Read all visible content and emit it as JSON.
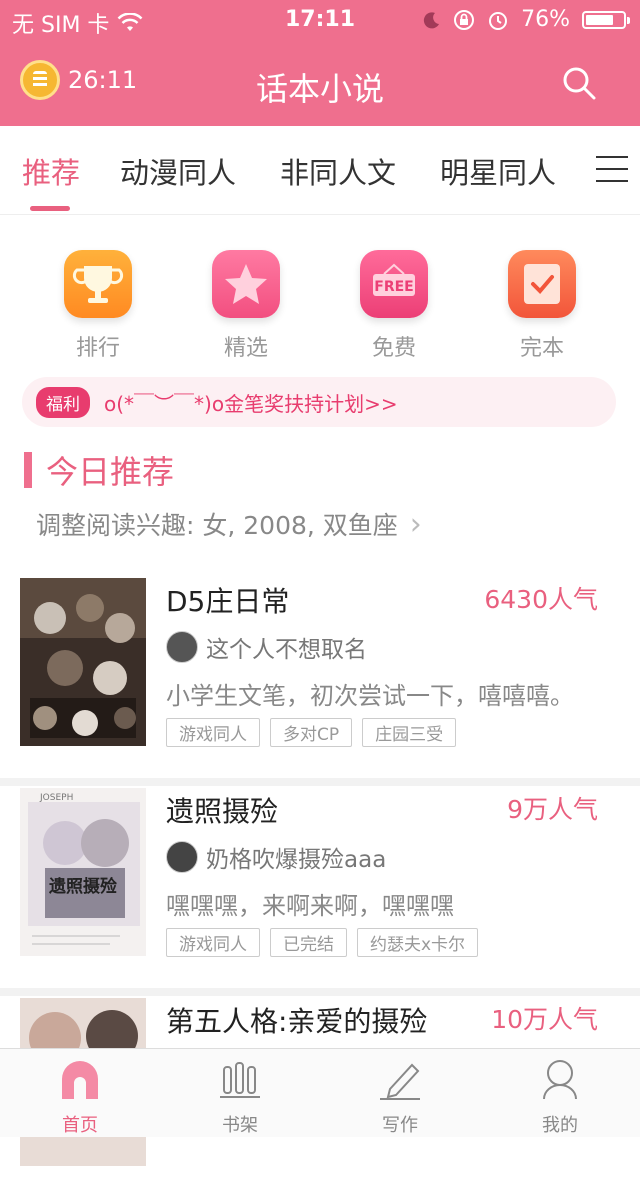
{
  "status_bar": {
    "carrier": "无 SIM 卡",
    "time": "17:11",
    "battery": "76%",
    "battery_level": 0.76
  },
  "header": {
    "timer": "26:11",
    "title": "话本小说"
  },
  "tabs": [
    {
      "label": "推荐",
      "active": true
    },
    {
      "label": "动漫同人"
    },
    {
      "label": "非同人文"
    },
    {
      "label": "明星同人"
    }
  ],
  "quick_links": [
    {
      "label": "排行",
      "icon": "trophy-icon"
    },
    {
      "label": "精选",
      "icon": "star-icon"
    },
    {
      "label": "免费",
      "icon": "free-sign-icon",
      "icon_text": "FREE"
    },
    {
      "label": "完本",
      "icon": "checkbook-icon"
    }
  ],
  "welfare": {
    "badge": "福利",
    "text": "o(*￣︶￣*)o金笔奖扶持计划>>"
  },
  "section": {
    "title": "今日推荐",
    "interest": "调整阅读兴趣: 女, 2008, 双鱼座"
  },
  "books": [
    {
      "title": "D5庄日常",
      "popularity": "6430人气",
      "author": "这个人不想取名",
      "description": "小学生文笔，初次尝试一下，嘻嘻嘻。",
      "tags": [
        "游戏同人",
        "多对CP",
        "庄园三受"
      ]
    },
    {
      "title": "遗照摄殓",
      "popularity": "9万人气",
      "author": "奶格吹爆摄殓aaa",
      "description": "嘿嘿嘿，来啊来啊，嘿嘿嘿",
      "tags": [
        "游戏同人",
        "已完结",
        "约瑟夫x卡尔"
      ],
      "cover_text": "遗照摄殓",
      "cover_header": "JOSEPH"
    },
    {
      "title": "第五人格:亲爱的摄殓",
      "popularity": "10万人气"
    }
  ],
  "bottom_nav": [
    {
      "label": "首页",
      "active": true
    },
    {
      "label": "书架"
    },
    {
      "label": "写作"
    },
    {
      "label": "我的"
    }
  ],
  "colors": {
    "brand": "#ef6f8e",
    "accent": "#e9607f",
    "welfare": "#e83c6e"
  }
}
